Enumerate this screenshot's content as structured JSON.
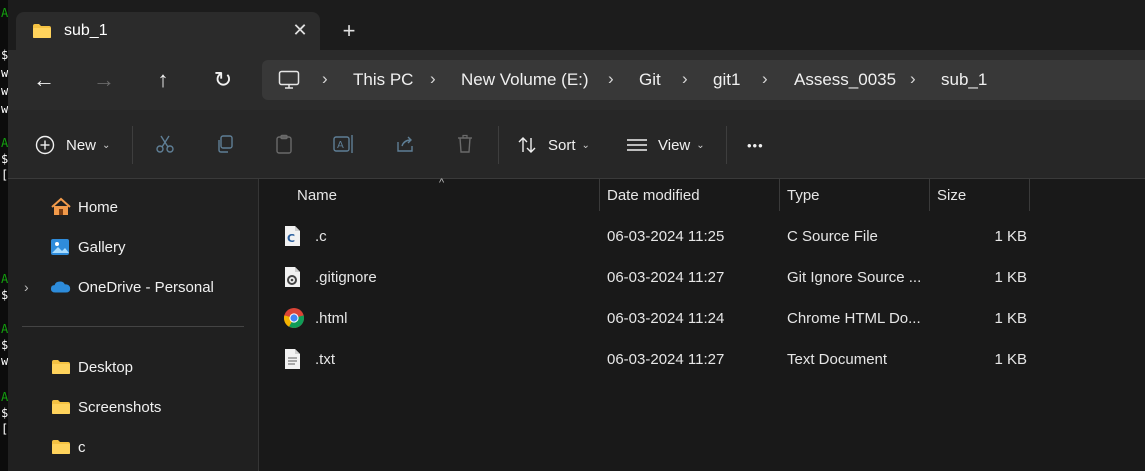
{
  "tab": {
    "title": "sub_1",
    "close": "✕",
    "add": "+"
  },
  "nav": {
    "back": "←",
    "forward": "→",
    "up": "↑",
    "refresh": "↻",
    "breadcrumbs": [
      "This PC",
      "New Volume (E:)",
      "Git",
      "git1",
      "Assess_0035",
      "sub_1"
    ],
    "separator": "›"
  },
  "commands": {
    "new_label": "New",
    "sort_label": "Sort",
    "view_label": "View",
    "more_label": "•••",
    "caret": "⌄"
  },
  "sidebar": {
    "items": [
      {
        "label": "Home",
        "icon": "home-icon"
      },
      {
        "label": "Gallery",
        "icon": "gallery-icon"
      },
      {
        "label": "OneDrive - Personal",
        "icon": "onedrive-cloud-icon"
      },
      {
        "label": "Desktop",
        "icon": "folder-icon"
      },
      {
        "label": "Screenshots",
        "icon": "folder-icon"
      },
      {
        "label": "c",
        "icon": "folder-icon"
      }
    ],
    "expander": "›"
  },
  "table": {
    "columns": [
      "Name",
      "Date modified",
      "Type",
      "Size"
    ],
    "sort_indicator": "^",
    "rows": [
      {
        "name": ".c",
        "date": "06-03-2024 11:25",
        "type": "C Source File",
        "size": "1 KB",
        "icon": "c-file-icon"
      },
      {
        "name": ".gitignore",
        "date": "06-03-2024 11:27",
        "type": "Git Ignore Source ...",
        "size": "1 KB",
        "icon": "settings-file-icon"
      },
      {
        "name": ".html",
        "date": "06-03-2024 11:24",
        "type": "Chrome HTML Do...",
        "size": "1 KB",
        "icon": "chrome-icon"
      },
      {
        "name": ".txt",
        "date": "06-03-2024 11:27",
        "type": "Text Document",
        "size": "1 KB",
        "icon": "text-file-icon"
      }
    ]
  },
  "terminal_fragments": [
    "A",
    "$",
    "w",
    "w",
    "w",
    "A",
    "$",
    "[",
    "A",
    "$",
    "A",
    "$",
    "w",
    "A",
    "$",
    "["
  ],
  "colors": {
    "folder": "#f5c242",
    "accent": "#4cc2ff",
    "onedrive": "#2d8cdb",
    "terminal_green": "#13a10e"
  }
}
